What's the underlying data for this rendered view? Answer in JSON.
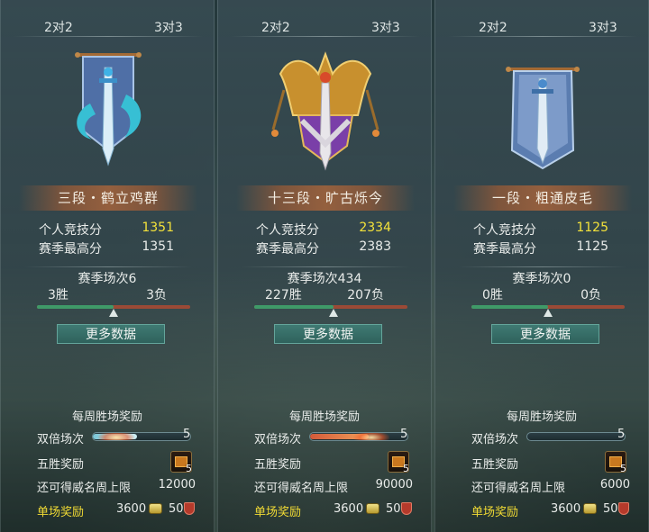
{
  "tabs": {
    "left": "2对2",
    "right": "3对3"
  },
  "labels": {
    "personal_score": "个人竞技分",
    "season_high": "赛季最高分",
    "more_data": "更多数据",
    "weekly_reward": "每周胜场奖励",
    "double_games": "双倍场次",
    "five_win_reward": "五胜奖励",
    "fame_cap": "还可得威名周上限",
    "single_reward": "单场奖励"
  },
  "panels": [
    {
      "rank": "三段・鹤立鸡群",
      "score": "1351",
      "high": "1351",
      "season_count": "赛季场次6",
      "wins": "3胜",
      "losses": "3负",
      "win_fraction": 0.5,
      "double_count": "5",
      "double_fill": 0.45,
      "chest_count": "5",
      "fame_cap": "12000",
      "reward_coin": "3600",
      "reward_fame": "50",
      "emblem": "dragon-sword-banner-icon"
    },
    {
      "rank": "十三段・旷古烁今",
      "score": "2334",
      "high": "2383",
      "season_count": "赛季场次434",
      "wins": "227胜",
      "losses": "207负",
      "win_fraction": 0.52,
      "double_count": "5",
      "double_fill": 0.6,
      "chest_count": "5",
      "fame_cap": "90000",
      "reward_coin": "3600",
      "reward_fame": "50",
      "emblem": "golden-crown-emblem-icon"
    },
    {
      "rank": "一段・粗通皮毛",
      "score": "1125",
      "high": "1125",
      "season_count": "赛季场次0",
      "wins": "0胜",
      "losses": "0负",
      "win_fraction": 0.5,
      "double_count": "5",
      "double_fill": 0.0,
      "chest_count": "5",
      "fame_cap": "6000",
      "reward_coin": "3600",
      "reward_fame": "50",
      "emblem": "blue-sword-banner-icon"
    }
  ],
  "colors": {
    "highlight": "#f4e23a",
    "single_reward_label": "#f0da34",
    "win_bar": "#3f9a68",
    "loss_bar": "#9b4a36"
  }
}
